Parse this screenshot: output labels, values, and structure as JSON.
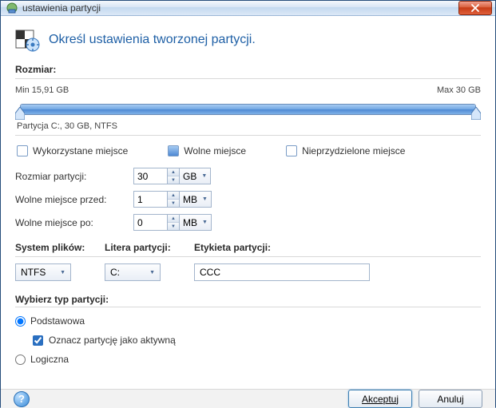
{
  "window": {
    "title": "ustawienia partycji"
  },
  "header": {
    "title": "Określ ustawienia tworzonej partycji."
  },
  "size": {
    "label": "Rozmiar:",
    "min_label": "Min 15,91 GB",
    "max_label": "Max 30 GB",
    "partition_desc": "Partycja C:, 30 GB, NTFS"
  },
  "legend": {
    "used": "Wykorzystane miejsce",
    "free": "Wolne miejsce",
    "unalloc": "Nieprzydzielone miejsce"
  },
  "form": {
    "partition_size_label": "Rozmiar partycji:",
    "partition_size_value": "30",
    "partition_size_unit": "GB",
    "free_before_label": "Wolne miejsce przed:",
    "free_before_value": "1",
    "free_before_unit": "MB",
    "free_after_label": "Wolne miejsce po:",
    "free_after_value": "0",
    "free_after_unit": "MB"
  },
  "trio": {
    "fs_label": "System plików:",
    "letter_label": "Litera partycji:",
    "vol_label": "Etykieta partycji:",
    "fs_value": "NTFS",
    "letter_value": "C:",
    "vol_value": "CCC"
  },
  "type": {
    "title": "Wybierz typ partycji:",
    "primary": "Podstawowa",
    "active": "Oznacz partycję jako aktywną",
    "logical": "Logiczna"
  },
  "footer": {
    "accept": "Akceptuj",
    "cancel": "Anuluj"
  }
}
